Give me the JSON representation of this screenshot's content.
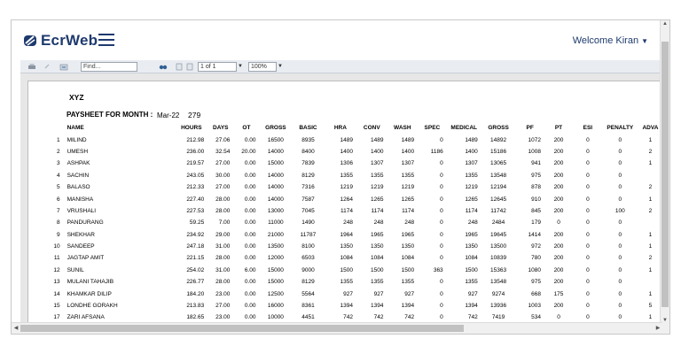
{
  "header": {
    "brand": "EcrWeb",
    "welcome": "Welcome Kiran",
    "brand_color": "#1e3a6e"
  },
  "toolbar": {
    "find_placeholder": "Find...",
    "page_value": "1 of 1",
    "zoom_value": "100%",
    "icons": [
      "print-icon",
      "back-icon",
      "export-icon",
      "binoculars-icon",
      "prev-page-icon",
      "next-page-icon"
    ]
  },
  "report": {
    "company": "XYZ",
    "paysheet_label": "PAYSHEET FOR MONTH :",
    "month": "Mar-22",
    "count": "279",
    "columns": [
      "",
      "NAME",
      "HOURS",
      "DAYS",
      "OT",
      "GROSS",
      "BASIC",
      "HRA",
      "CONV",
      "WASH",
      "SPEC",
      "MEDICAL",
      "GROSS",
      "PF",
      "PT",
      "ESI",
      "PENALTY",
      "ADVA"
    ],
    "rows": [
      [
        "1",
        "MILIND",
        "212.98",
        "27.06",
        "0.00",
        "16500",
        "8935",
        "1489",
        "1489",
        "1489",
        "0",
        "1489",
        "14892",
        "1072",
        "200",
        "0",
        "0",
        "1"
      ],
      [
        "2",
        "UMESH",
        "236.00",
        "32.54",
        "20.00",
        "14000",
        "8400",
        "1400",
        "1400",
        "1400",
        "1186",
        "1400",
        "15186",
        "1008",
        "200",
        "0",
        "0",
        "2"
      ],
      [
        "3",
        "ASHPAK",
        "219.57",
        "27.00",
        "0.00",
        "15000",
        "7839",
        "1306",
        "1307",
        "1307",
        "0",
        "1307",
        "13065",
        "941",
        "200",
        "0",
        "0",
        "1"
      ],
      [
        "4",
        "SACHIN",
        "243.05",
        "30.00",
        "0.00",
        "14000",
        "8129",
        "1355",
        "1355",
        "1355",
        "0",
        "1355",
        "13548",
        "975",
        "200",
        "0",
        "0",
        ""
      ],
      [
        "5",
        "BALASO",
        "212.33",
        "27.00",
        "0.00",
        "14000",
        "7316",
        "1219",
        "1219",
        "1219",
        "0",
        "1219",
        "12194",
        "878",
        "200",
        "0",
        "0",
        "2"
      ],
      [
        "6",
        "MANISHA",
        "227.40",
        "28.00",
        "0.00",
        "14000",
        "7587",
        "1264",
        "1265",
        "1265",
        "0",
        "1265",
        "12645",
        "910",
        "200",
        "0",
        "0",
        "1"
      ],
      [
        "7",
        "VRUSHALI",
        "227.53",
        "28.00",
        "0.00",
        "13000",
        "7045",
        "1174",
        "1174",
        "1174",
        "0",
        "1174",
        "11742",
        "845",
        "200",
        "0",
        "100",
        "2"
      ],
      [
        "8",
        "PANDURANG",
        "59.25",
        "7.00",
        "0.00",
        "11000",
        "1490",
        "248",
        "248",
        "248",
        "0",
        "248",
        "2484",
        "179",
        "0",
        "0",
        "0",
        ""
      ],
      [
        "9",
        "SHEKHAR",
        "234.92",
        "29.00",
        "0.00",
        "21000",
        "11787",
        "1964",
        "1965",
        "1965",
        "0",
        "1965",
        "19645",
        "1414",
        "200",
        "0",
        "0",
        "1"
      ],
      [
        "10",
        "SANDEEP",
        "247.18",
        "31.00",
        "0.00",
        "13500",
        "8100",
        "1350",
        "1350",
        "1350",
        "0",
        "1350",
        "13500",
        "972",
        "200",
        "0",
        "0",
        "1"
      ],
      [
        "11",
        "JAGTAP AMIT",
        "221.15",
        "28.00",
        "0.00",
        "12000",
        "6503",
        "1084",
        "1084",
        "1084",
        "0",
        "1084",
        "10839",
        "780",
        "200",
        "0",
        "0",
        "2"
      ],
      [
        "12",
        "SUNIL",
        "254.02",
        "31.00",
        "6.00",
        "15000",
        "9000",
        "1500",
        "1500",
        "1500",
        "363",
        "1500",
        "15363",
        "1080",
        "200",
        "0",
        "0",
        "1"
      ],
      [
        "13",
        "MULANI TAHAJIB",
        "226.77",
        "28.00",
        "0.00",
        "15000",
        "8129",
        "1355",
        "1355",
        "1355",
        "0",
        "1355",
        "13548",
        "975",
        "200",
        "0",
        "0",
        ""
      ],
      [
        "14",
        "KHAMKAR DILIP",
        "184.20",
        "23.00",
        "0.00",
        "12500",
        "5564",
        "927",
        "927",
        "927",
        "0",
        "927",
        "9274",
        "668",
        "175",
        "0",
        "0",
        "1"
      ],
      [
        "15",
        "LONDHE GORAKH",
        "213.83",
        "27.00",
        "0.00",
        "16000",
        "8361",
        "1394",
        "1394",
        "1394",
        "0",
        "1394",
        "13936",
        "1003",
        "200",
        "0",
        "0",
        "5"
      ],
      [
        "17",
        "ZARI AFSANA",
        "182.65",
        "23.00",
        "0.00",
        "10000",
        "4451",
        "742",
        "742",
        "742",
        "0",
        "742",
        "7419",
        "534",
        "0",
        "0",
        "0",
        "1"
      ]
    ]
  }
}
